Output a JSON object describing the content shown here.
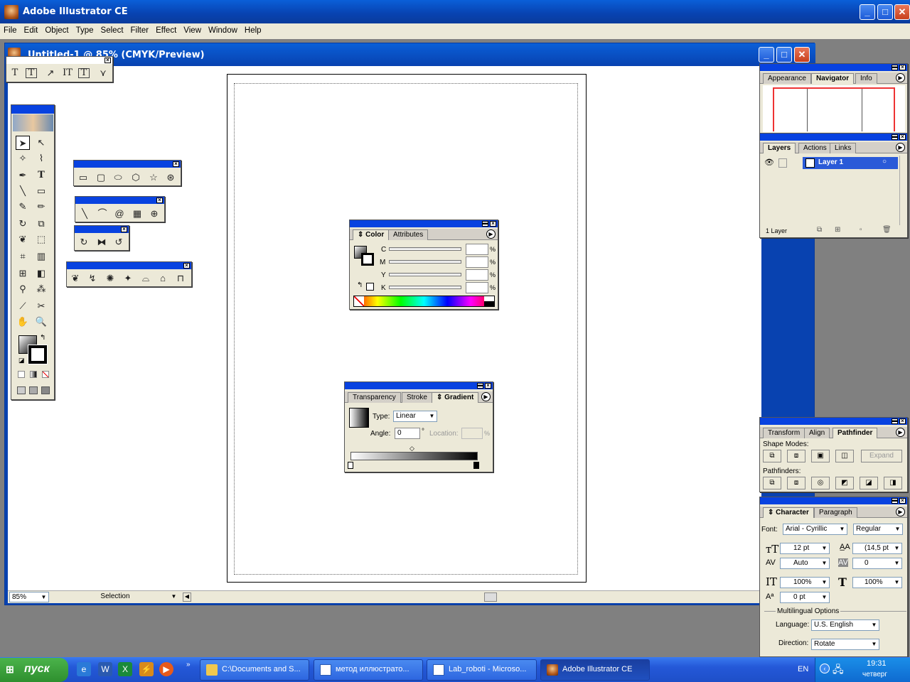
{
  "app": {
    "title": "Adobe Illustrator CE"
  },
  "menu": [
    "File",
    "Edit",
    "Object",
    "Type",
    "Select",
    "Filter",
    "Effect",
    "View",
    "Window",
    "Help"
  ],
  "document": {
    "title": "Untitled-1 @ 85% (CMYK/Preview)",
    "zoom": "85%",
    "status_mode": "Selection"
  },
  "type_tools": [
    "T",
    "T",
    "↗",
    "IT",
    "T",
    "⋎"
  ],
  "color_panel": {
    "tabs": [
      "Color",
      "Attributes"
    ],
    "channels": [
      "C",
      "M",
      "Y",
      "K"
    ],
    "unit": "%"
  },
  "gradient_panel": {
    "tabs": [
      "Transparency",
      "Stroke",
      "Gradient"
    ],
    "type_label": "Type:",
    "type_value": "Linear",
    "angle_label": "Angle:",
    "angle_value": "0",
    "angle_unit": "°",
    "location_label": "Location:",
    "location_unit": "%"
  },
  "navigator_panel": {
    "tabs": [
      "Appearance",
      "Navigator",
      "Info"
    ]
  },
  "layers_panel": {
    "tabs": [
      "Layers",
      "Actions",
      "Links"
    ],
    "layer_name": "Layer 1",
    "count": "1 Layer"
  },
  "pathfinder_panel": {
    "tabs": [
      "Transform",
      "Align",
      "Pathfinder"
    ],
    "shape_modes": "Shape Modes:",
    "expand": "Expand",
    "pathfinders": "Pathfinders:"
  },
  "character_panel": {
    "tabs": [
      "Character",
      "Paragraph"
    ],
    "font_label": "Font:",
    "font": "Arial - Cyrillic",
    "style": "Regular",
    "size": "12 pt",
    "leading": "(14,5 pt",
    "kerning": "Auto",
    "tracking": "0",
    "vscale": "100%",
    "hscale": "100%",
    "baseline": "0 pt",
    "multilingual": "Multilingual Options",
    "language_label": "Language:",
    "language": "U.S. English",
    "direction_label": "Direction:",
    "direction": "Rotate"
  },
  "taskbar": {
    "start": "пуск",
    "tasks": [
      "C:\\Documents and S...",
      "метод иллюстрато...",
      "Lab_roboti - Microso...",
      "Adobe Illustrator CE"
    ],
    "lang": "EN",
    "time": "19:31",
    "day": "четверг"
  }
}
